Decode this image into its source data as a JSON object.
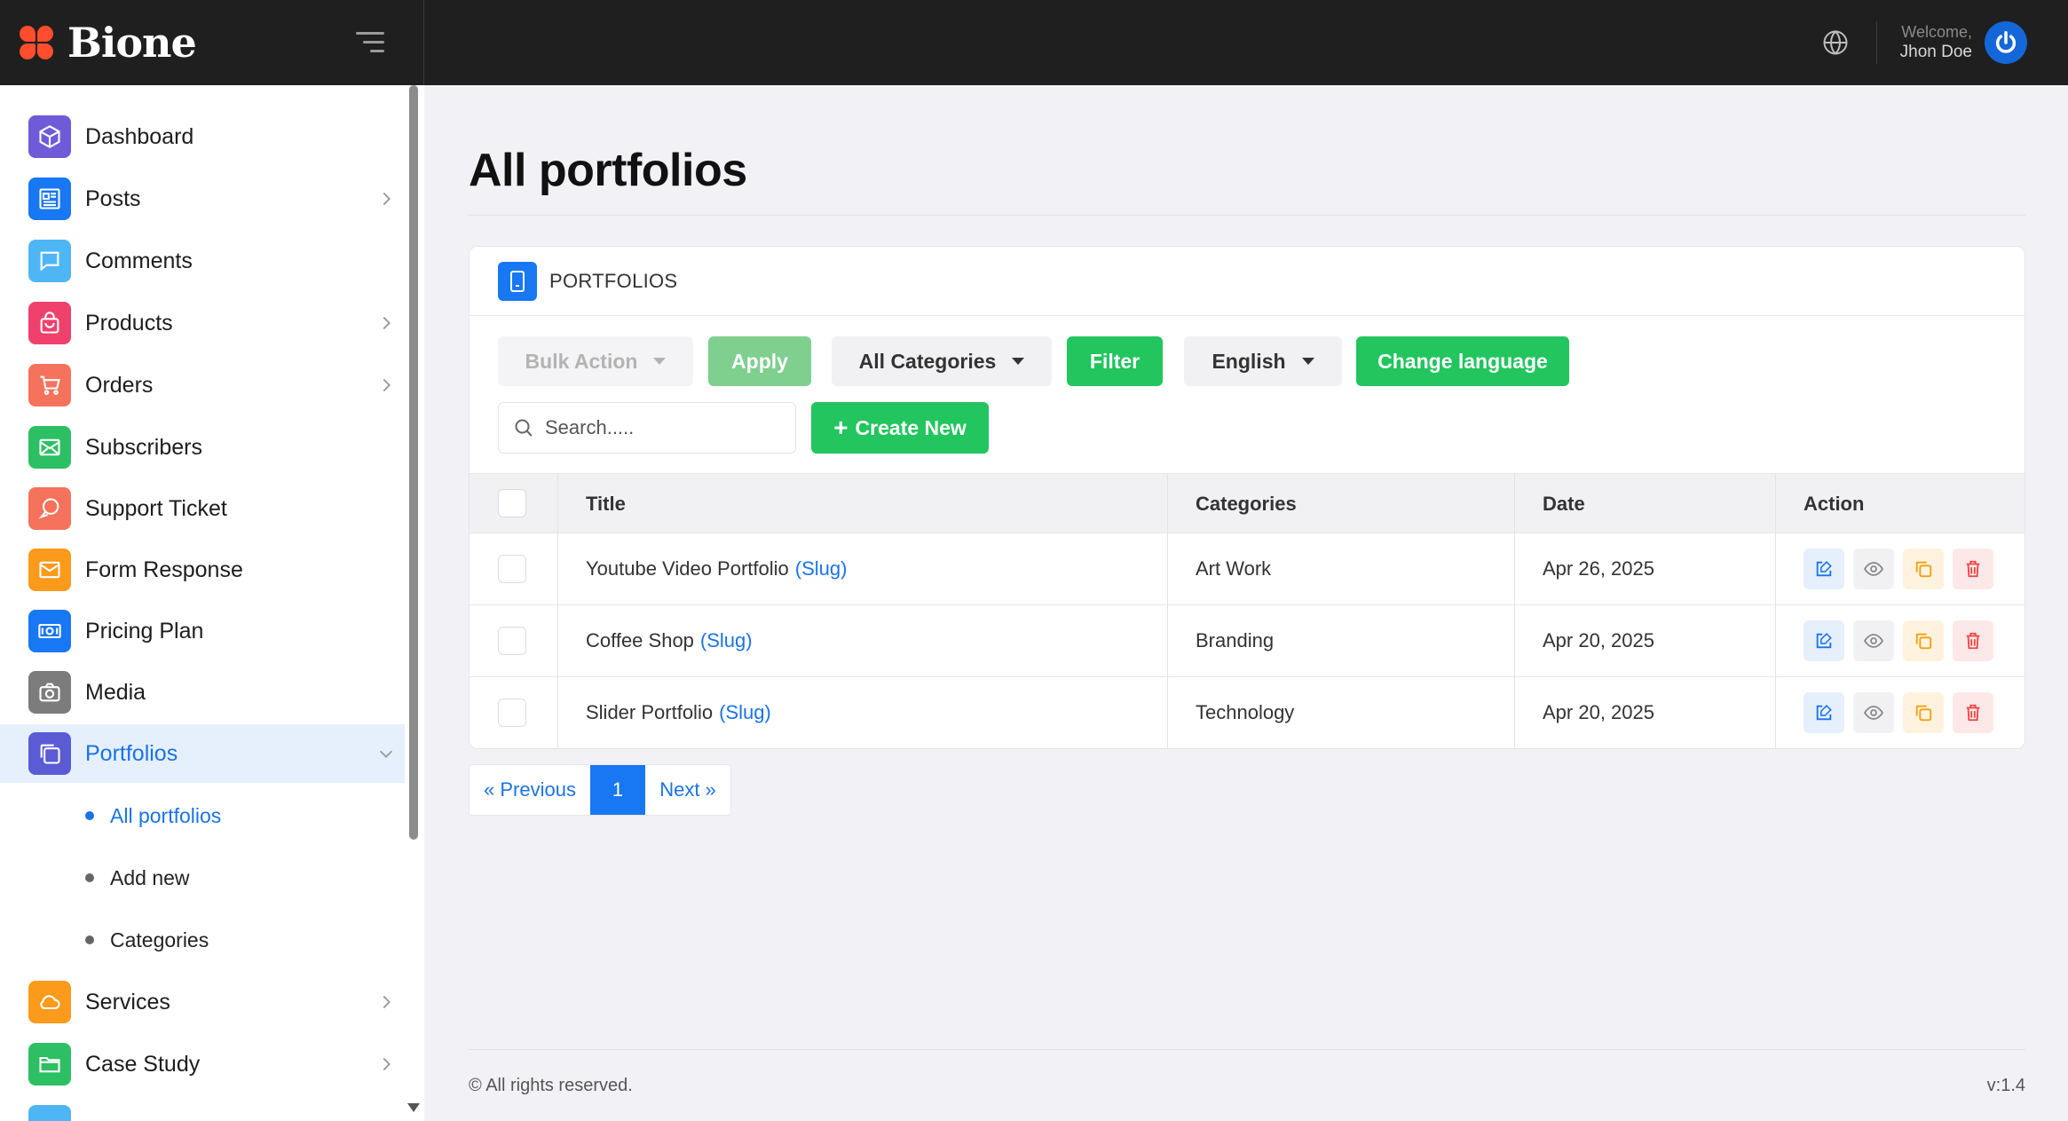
{
  "brand": {
    "name": "Bione",
    "color": "#ff4d2e"
  },
  "topbar": {
    "welcome": "Welcome,",
    "user_name": "Jhon Doe"
  },
  "sidebar": {
    "items": [
      {
        "label": "Dashboard",
        "icon": "cube-icon",
        "color": "#6f5bd8",
        "has_children": false
      },
      {
        "label": "Posts",
        "icon": "newspaper-icon",
        "color": "#1877f2",
        "has_children": true
      },
      {
        "label": "Comments",
        "icon": "chat-bubble-icon",
        "color": "#4fb6f5",
        "has_children": false
      },
      {
        "label": "Products",
        "icon": "shopping-bag-icon",
        "color": "#f0416c",
        "has_children": true
      },
      {
        "label": "Orders",
        "icon": "cart-icon",
        "color": "#f5725c",
        "has_children": true
      },
      {
        "label": "Subscribers",
        "icon": "envelope-icon",
        "color": "#2dbf63",
        "has_children": false
      },
      {
        "label": "Support Ticket",
        "icon": "support-chat-icon",
        "color": "#f5725c",
        "has_children": false
      },
      {
        "label": "Form Response",
        "icon": "mail-icon",
        "color": "#fb9a1b",
        "has_children": false
      },
      {
        "label": "Pricing Plan",
        "icon": "money-icon",
        "color": "#1877f2",
        "has_children": false
      },
      {
        "label": "Media",
        "icon": "camera-icon",
        "color": "#7c7c7c",
        "has_children": false
      },
      {
        "label": "Portfolios",
        "icon": "copy-icon",
        "color": "#5b5bd6",
        "has_children": true,
        "active": true
      },
      {
        "label": "Services",
        "icon": "cloud-icon",
        "color": "#fb9a1b",
        "has_children": true
      },
      {
        "label": "Case Study",
        "icon": "folder-icon",
        "color": "#2dbf63",
        "has_children": true
      }
    ],
    "sub_items": [
      {
        "label": "All portfolios",
        "active": true
      },
      {
        "label": "Add new"
      },
      {
        "label": "Categories"
      }
    ]
  },
  "main": {
    "title": "All portfolios",
    "card_title": "PORTFOLIOS",
    "toolbar": {
      "bulk_action": "Bulk Action",
      "apply": "Apply",
      "all_categories": "All Categories",
      "filter": "Filter",
      "language": "English",
      "change_language": "Change language",
      "search_placeholder": "Search.....",
      "create_new": "Create New"
    },
    "table": {
      "columns": [
        "Title",
        "Categories",
        "Date",
        "Action"
      ],
      "slug_label": "(Slug)",
      "rows": [
        {
          "title": "Youtube Video Portfolio",
          "category": "Art Work",
          "date": "Apr 26, 2025"
        },
        {
          "title": "Coffee Shop",
          "category": "Branding",
          "date": "Apr 20, 2025"
        },
        {
          "title": "Slider Portfolio",
          "category": "Technology",
          "date": "Apr 20, 2025"
        }
      ]
    },
    "pagination": {
      "prev": "« Previous",
      "current": "1",
      "next": "Next »"
    }
  },
  "footer": {
    "copyright": "© All rights reserved.",
    "version": "v:1.4"
  },
  "colors": {
    "accent_blue": "#1877f2",
    "accent_green": "#22c55e",
    "topbar": "#1f1f1f"
  }
}
